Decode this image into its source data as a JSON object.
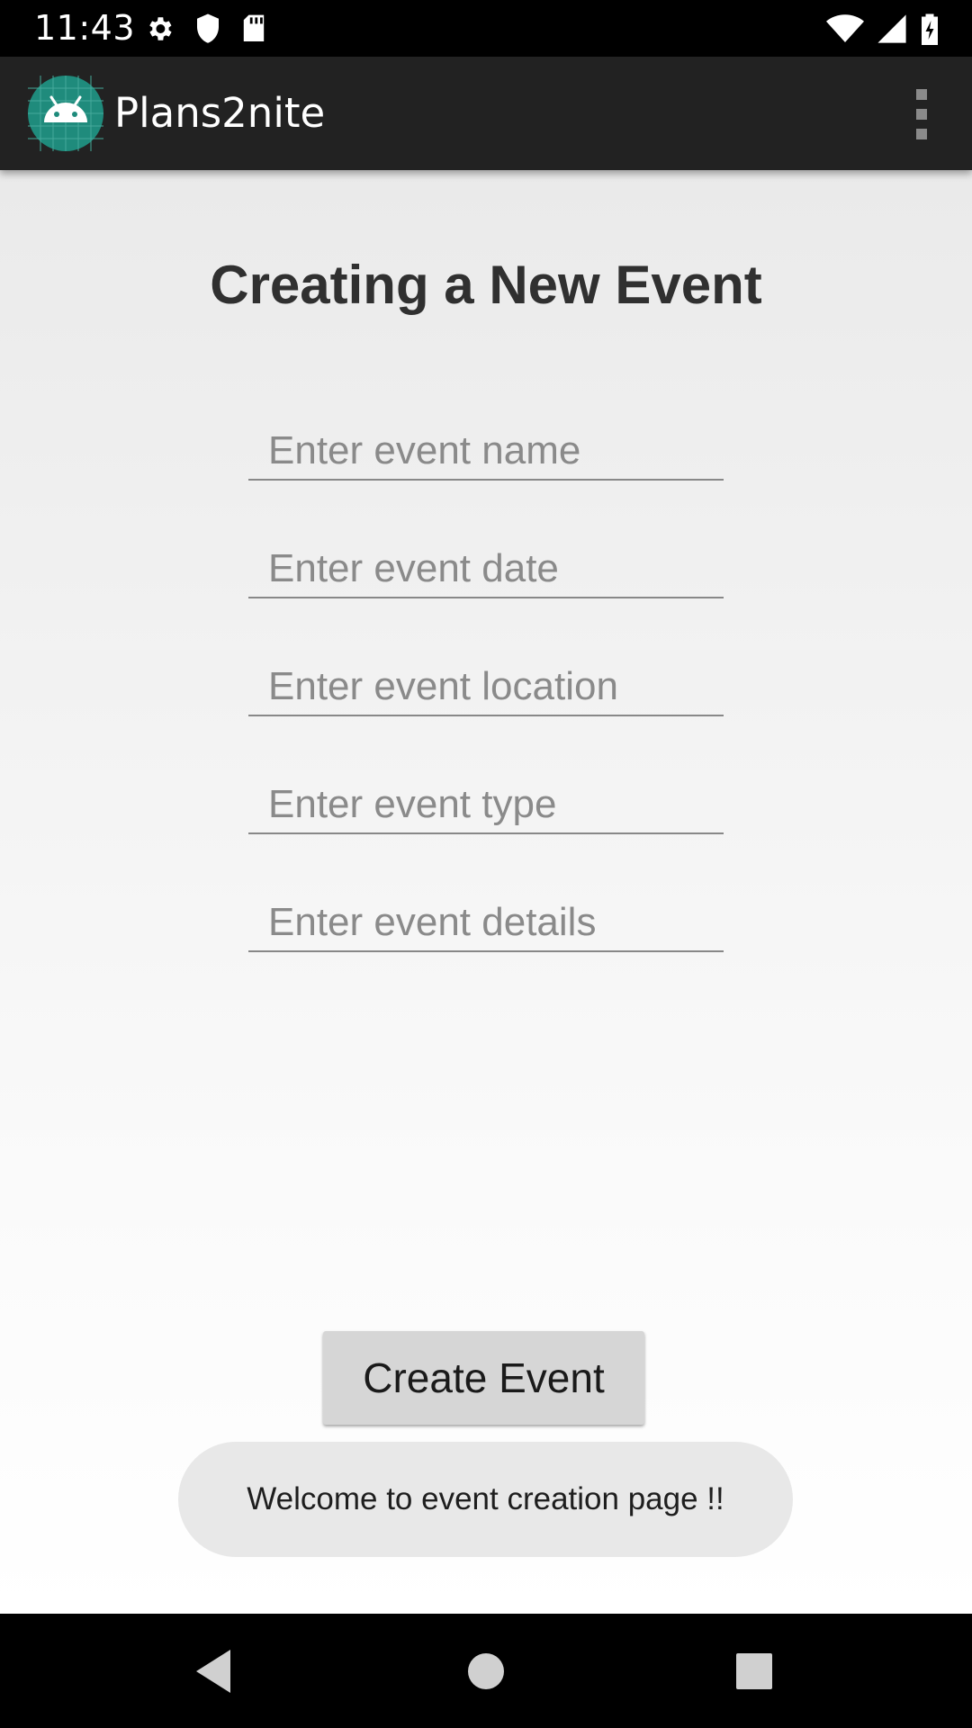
{
  "status_bar": {
    "time": "11:43",
    "left_icons": [
      "gear-icon",
      "shield-icon",
      "sd-card-icon"
    ],
    "right_icons": [
      "wifi-icon",
      "cell-signal-icon",
      "battery-charging-icon"
    ]
  },
  "app_bar": {
    "title": "Plans2nite",
    "logo_icon": "android-logo-icon",
    "menu_icon": "overflow-menu-icon"
  },
  "page": {
    "title": "Creating a New Event"
  },
  "form": {
    "fields": [
      {
        "placeholder": "Enter event name",
        "value": ""
      },
      {
        "placeholder": "Enter event date",
        "value": ""
      },
      {
        "placeholder": "Enter event location",
        "value": ""
      },
      {
        "placeholder": "Enter event type",
        "value": ""
      },
      {
        "placeholder": "Enter event details",
        "value": ""
      }
    ],
    "submit_label": "Create Event"
  },
  "toast": {
    "message": "Welcome to event creation page !!"
  },
  "nav_bar": {
    "icons": [
      "back-icon",
      "home-icon",
      "recents-icon"
    ]
  },
  "colors": {
    "app_bar": "#222222",
    "logo_bg": "#1f8b7c",
    "button": "#d6d6d6",
    "toast": "#e8e8e8"
  }
}
